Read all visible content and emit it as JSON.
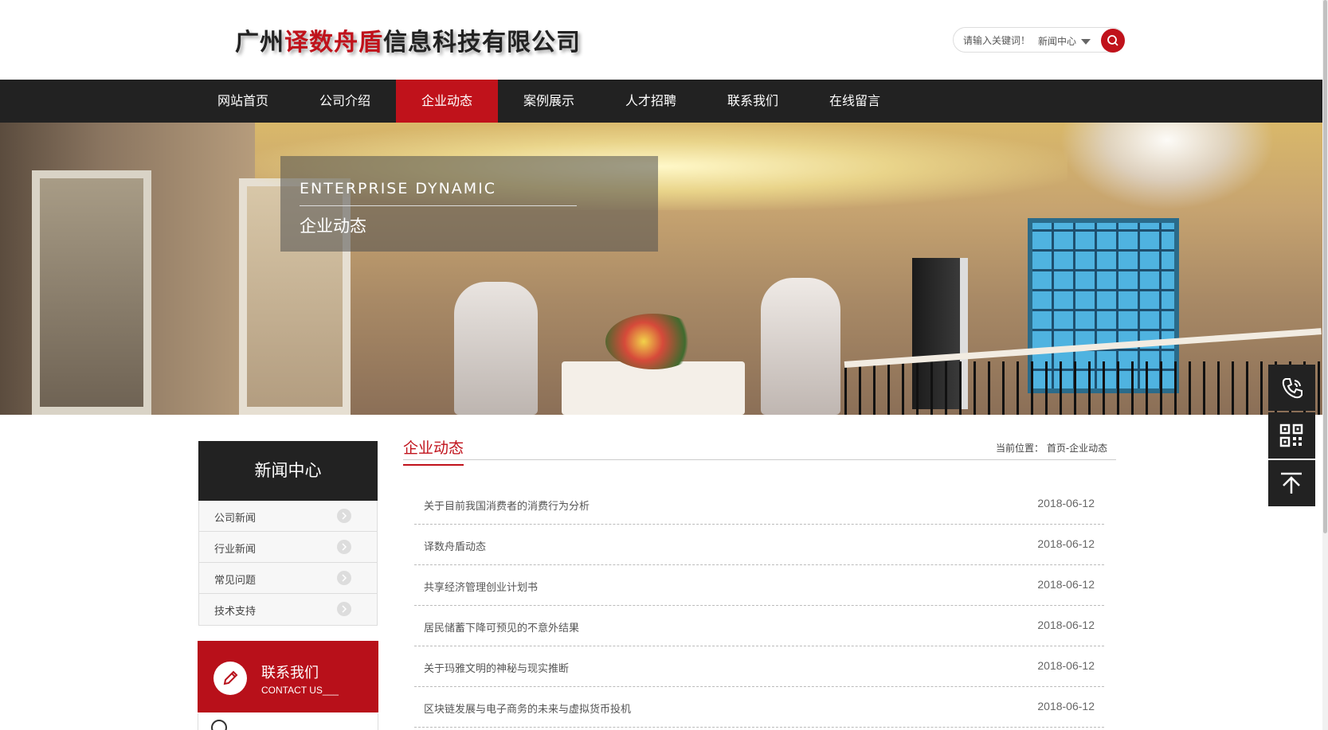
{
  "header": {
    "logo_part1": "广州",
    "logo_part2": "译数舟盾",
    "logo_part3": "信息科技有限公司",
    "search_placeholder": "请输入关键词！",
    "search_scope": "新闻中心",
    "search_icon": "search-icon"
  },
  "nav": {
    "items": [
      {
        "label": "网站首页",
        "active": false
      },
      {
        "label": "公司介绍",
        "active": false
      },
      {
        "label": "企业动态",
        "active": true
      },
      {
        "label": "案例展示",
        "active": false
      },
      {
        "label": "人才招聘",
        "active": false
      },
      {
        "label": "联系我们",
        "active": false
      },
      {
        "label": "在线留言",
        "active": false
      }
    ]
  },
  "banner": {
    "title_en": "ENTERPRISE DYNAMIC",
    "title_cn": "企业动态"
  },
  "sidebar": {
    "heading": "新闻中心",
    "items": [
      {
        "label": "公司新闻"
      },
      {
        "label": "行业新闻"
      },
      {
        "label": "常见问题"
      },
      {
        "label": "技术支持"
      }
    ],
    "contact": {
      "title_cn": "联系我们",
      "title_en": "CONTACT US___"
    }
  },
  "main": {
    "title": "企业动态",
    "breadcrumb": "当前位置： 首页-企业动态",
    "news": [
      {
        "title": "关于目前我国消费者的消费行为分析",
        "date": "2018-06-12"
      },
      {
        "title": "译数舟盾动态",
        "date": "2018-06-12"
      },
      {
        "title": "共享经济管理创业计划书",
        "date": "2018-06-12"
      },
      {
        "title": "居民储蓄下降可预见的不意外结果",
        "date": "2018-06-12"
      },
      {
        "title": "关于玛雅文明的神秘与现实推断",
        "date": "2018-06-12"
      },
      {
        "title": "区块链发展与电子商务的未来与虚拟货币投机",
        "date": "2018-06-12"
      }
    ]
  },
  "float_tools": [
    {
      "icon": "phone-icon"
    },
    {
      "icon": "qr-code-icon"
    },
    {
      "icon": "back-to-top-icon"
    }
  ],
  "colors": {
    "accent": "#c0121b",
    "nav_bg": "#222222"
  }
}
